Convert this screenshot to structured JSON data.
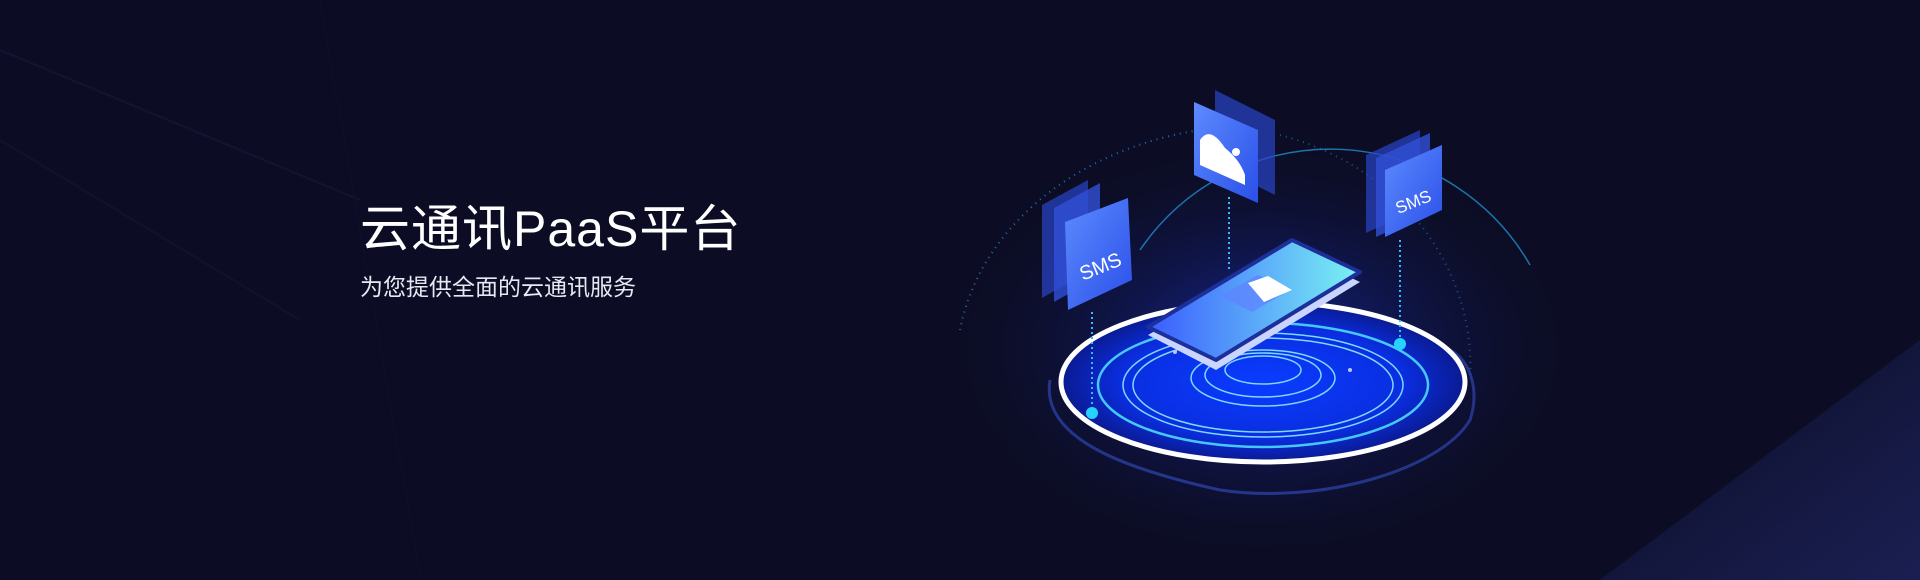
{
  "hero": {
    "title": "云通讯PaaS平台",
    "subtitle": "为您提供全面的云通讯服务"
  },
  "illustration": {
    "card_left_label": "SMS",
    "card_right_label": "SMS",
    "card_center_icon": "image-icon",
    "phone_icon": "envelope-icon"
  },
  "colors": {
    "background": "#0c0d24",
    "accent": "#2f5bff",
    "cyan": "#3fd8ff"
  }
}
